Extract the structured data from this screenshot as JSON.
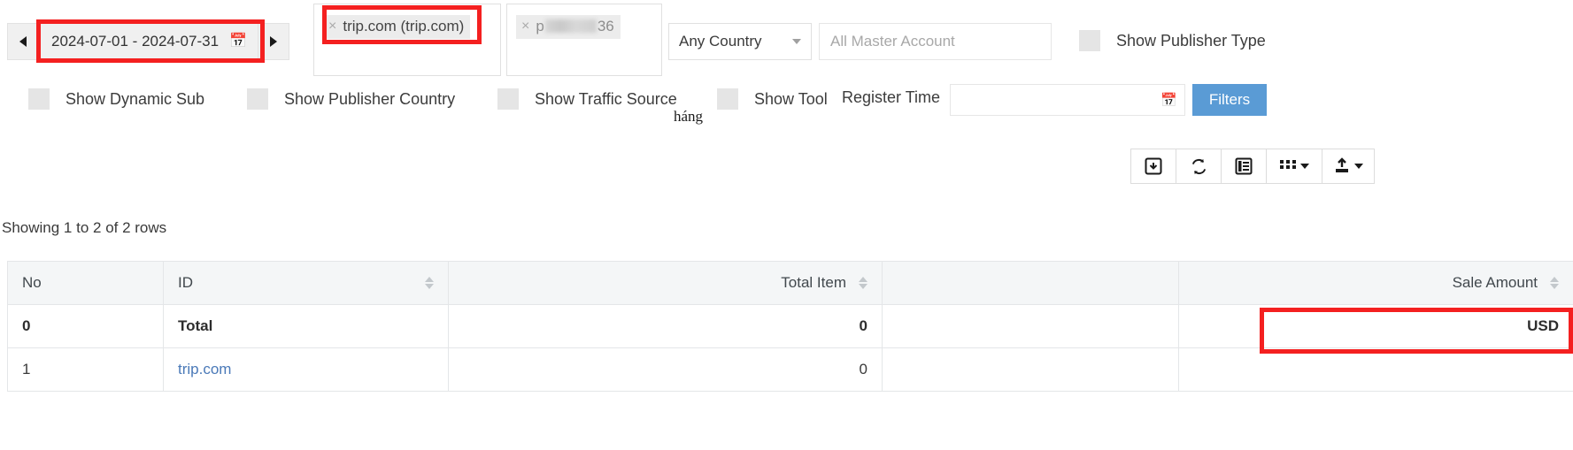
{
  "filters": {
    "date_range": {
      "value": "2024-07-01 - 2024-07-31",
      "calendar_icon": "calendar-icon",
      "prev_icon": "chevron-left-icon",
      "next_icon": "chevron-right-icon"
    },
    "publisher_tokens": [
      {
        "remove_icon": "close-icon",
        "label": "trip.com (trip.com)",
        "redacted": false
      },
      {
        "remove_icon": "close-icon",
        "label_prefix": "p",
        "label_suffix": "36",
        "redacted": true
      }
    ],
    "country_select": {
      "value": "Any Country",
      "caret_icon": "chevron-down-icon"
    },
    "master_account": {
      "value": "",
      "placeholder": "All Master Account"
    },
    "checkboxes": [
      {
        "label": "Show Publisher Type",
        "checked": false
      },
      {
        "label": "Show Dynamic Sub",
        "checked": false
      },
      {
        "label": "Show Publisher Country",
        "checked": false
      },
      {
        "label": "Show Traffic Source",
        "checked": false
      },
      {
        "label": "Show Tool",
        "checked": false
      }
    ],
    "register_time": {
      "label": "Register Time",
      "value": "",
      "calendar_icon": "calendar-icon"
    },
    "filters_button": {
      "label": "Filters",
      "color": "#5a9bd5"
    },
    "artifact_text": "háng"
  },
  "toolbar": {
    "buttons": [
      {
        "icon": "export-box-icon",
        "label": ""
      },
      {
        "icon": "refresh-icon",
        "label": ""
      },
      {
        "icon": "detail-list-icon",
        "label": ""
      },
      {
        "icon": "columns-grid-icon",
        "label": "",
        "caret_icon": "chevron-down-icon"
      },
      {
        "icon": "export-upload-icon",
        "label": "",
        "caret_icon": "chevron-down-icon"
      }
    ]
  },
  "table": {
    "status_text": "Showing 1 to 2 of 2 rows",
    "columns": [
      {
        "label": "No",
        "align": "left",
        "sortable": false
      },
      {
        "label": "ID",
        "align": "left",
        "sortable": true
      },
      {
        "label": "Total Item",
        "align": "right",
        "sortable": true
      },
      {
        "label": "",
        "align": "left",
        "sortable": false
      },
      {
        "label": "Sale Amount",
        "align": "right",
        "sortable": true
      }
    ],
    "rows": [
      {
        "no": "0",
        "id": "Total",
        "total_item": "0",
        "blank": "",
        "sale_amount": "USD",
        "is_total": true,
        "id_is_link": false
      },
      {
        "no": "1",
        "id": "trip.com",
        "total_item": "0",
        "blank": "",
        "sale_amount": "",
        "is_total": false,
        "id_is_link": true
      }
    ]
  },
  "annotations": {
    "highlight_color": "#f42020",
    "boxes": [
      {
        "name": "date-range-highlight"
      },
      {
        "name": "publisher-token-highlight"
      },
      {
        "name": "sale-amount-usd-highlight"
      }
    ]
  }
}
